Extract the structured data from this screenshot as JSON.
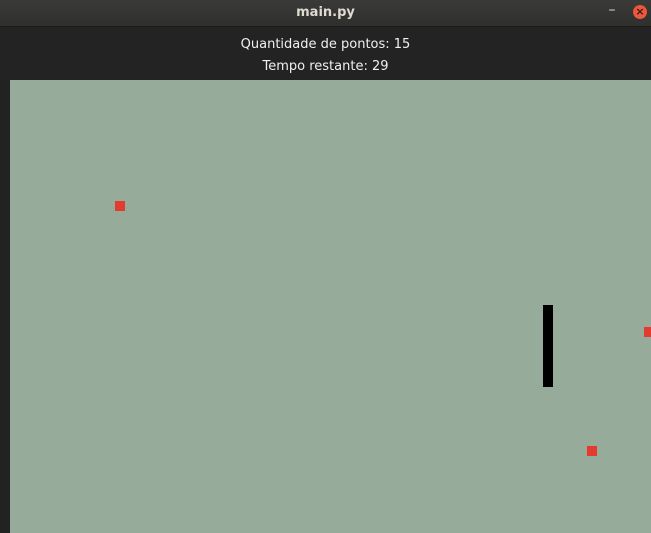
{
  "window": {
    "title": "main.py",
    "minimize_glyph": "–",
    "close_glyph": "×"
  },
  "hud": {
    "score_text": "Quantidade de pontos: 15",
    "time_text": "Tempo restante: 29"
  },
  "colors": {
    "field": "#97ab9a",
    "food": "#e23b2f",
    "snake": "#000000",
    "hud_background": "#232323",
    "hud_text": "#f0f0f0"
  },
  "game": {
    "food_count": 3,
    "snake_orientation": "vertical"
  }
}
